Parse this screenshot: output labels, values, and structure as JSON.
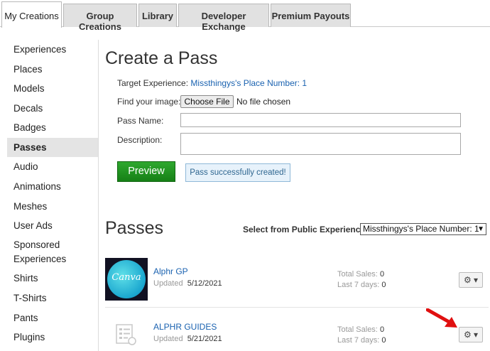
{
  "tabs": [
    "My Creations",
    "Group Creations",
    "Library",
    "Developer Exchange",
    "Premium Payouts"
  ],
  "sidebar": {
    "items": [
      "Experiences",
      "Places",
      "Models",
      "Decals",
      "Badges",
      "Passes",
      "Audio",
      "Animations",
      "Meshes",
      "User Ads",
      "Sponsored Experiences",
      "Shirts",
      "T-Shirts",
      "Pants",
      "Plugins"
    ],
    "active": "Passes"
  },
  "create": {
    "title": "Create a Pass",
    "target_label": "Target Experience:",
    "target_value": "Missthingys's Place Number: 1",
    "image_label": "Find your image:",
    "choose_file": "Choose File",
    "no_file": "No file chosen",
    "name_label": "Pass Name:",
    "desc_label": "Description:",
    "preview": "Preview",
    "success": "Pass successfully created!"
  },
  "passes": {
    "heading": "Passes",
    "select_label": "Select from Public Experiences:",
    "select_value": "Missthingys's Place Number: 1",
    "items": [
      {
        "name": "Alphr GP",
        "updated_label": "Updated",
        "updated": "5/12/2021",
        "total_label": "Total Sales:",
        "total": "0",
        "last_label": "Last 7 days:",
        "last": "0",
        "thumb_text": "Canva"
      },
      {
        "name": "ALPHR GUIDES",
        "updated_label": "Updated",
        "updated": "5/21/2021",
        "total_label": "Total Sales:",
        "total": "0",
        "last_label": "Last 7 days:",
        "last": "0"
      }
    ],
    "gear_label": "⚙ ▾"
  },
  "colors": {
    "link": "#1a62b0",
    "preview_green": "#1f931f",
    "arrow_red": "#e01010"
  }
}
